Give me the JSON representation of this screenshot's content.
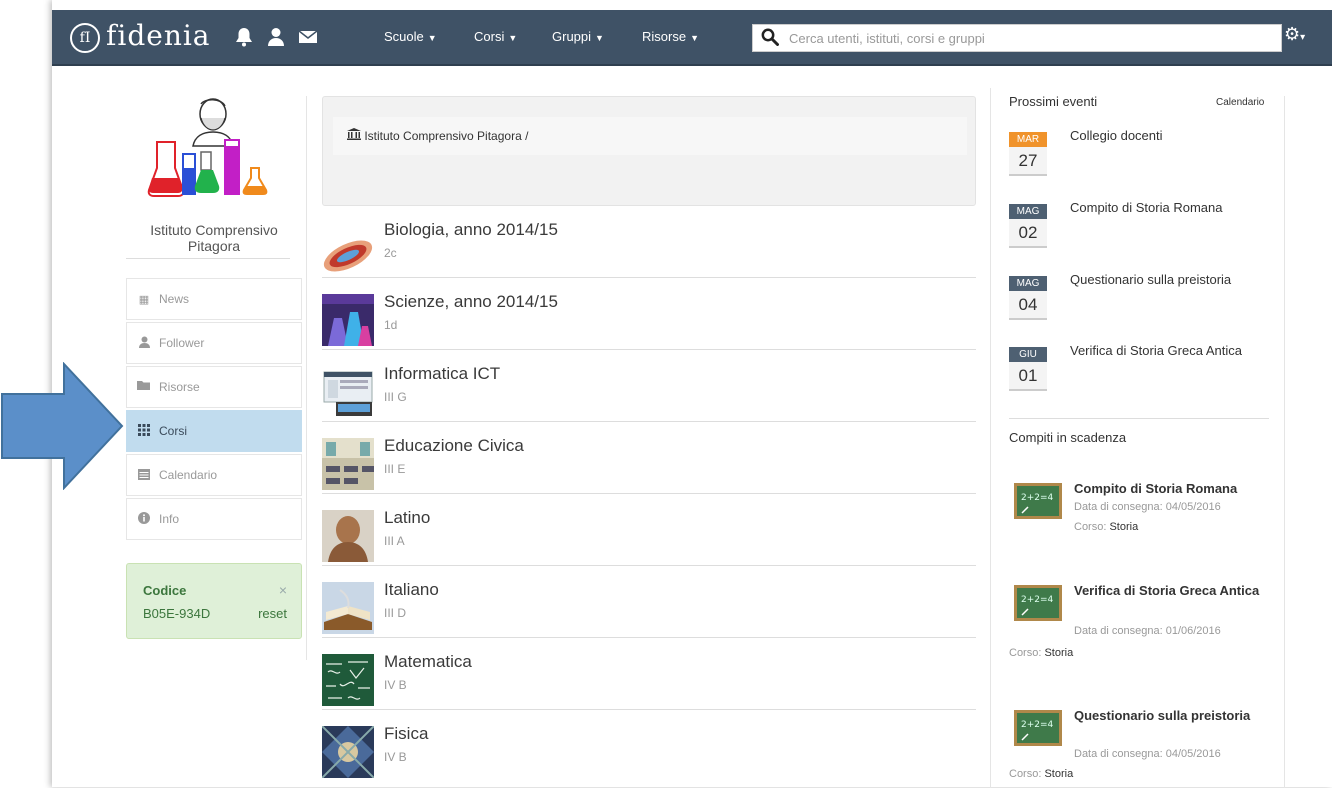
{
  "navbar": {
    "logo_mark": "fI",
    "logo_text": "fidenia",
    "menus": [
      {
        "label": "Scuole"
      },
      {
        "label": "Corsi"
      },
      {
        "label": "Gruppi"
      },
      {
        "label": "Risorse"
      }
    ],
    "search_placeholder": "Cerca utenti, istituti, corsi e gruppi",
    "colors": {
      "bar": "#3f5266"
    }
  },
  "school": {
    "name": "Istituto Comprensivo Pitagora"
  },
  "sidenav": {
    "items": [
      {
        "label": "News",
        "icon": "newspaper-icon"
      },
      {
        "label": "Follower",
        "icon": "user-icon"
      },
      {
        "label": "Risorse",
        "icon": "folder-icon"
      },
      {
        "label": "Corsi",
        "icon": "grid-icon",
        "active": true
      },
      {
        "label": "Calendario",
        "icon": "calendar-icon"
      },
      {
        "label": "Info",
        "icon": "info-icon"
      }
    ]
  },
  "code_box": {
    "title": "Codice",
    "close": "×",
    "value": "B05E-934D",
    "reset": "reset"
  },
  "breadcrumb": {
    "text": "Istituto Comprensivo Pitagora /"
  },
  "courses": [
    {
      "title": "Biologia, anno 2014/15",
      "sub": "2c"
    },
    {
      "title": "Scienze, anno 2014/15",
      "sub": "1d"
    },
    {
      "title": "Informatica ICT",
      "sub": "III G"
    },
    {
      "title": "Educazione Civica",
      "sub": "III E"
    },
    {
      "title": "Latino",
      "sub": "III A"
    },
    {
      "title": "Italiano",
      "sub": "III D"
    },
    {
      "title": "Matematica",
      "sub": "IV B"
    },
    {
      "title": "Fisica",
      "sub": "IV B"
    }
  ],
  "events": {
    "heading": "Prossimi eventi",
    "calendar_link": "Calendario",
    "items": [
      {
        "month": "MAR",
        "day": "27",
        "title": "Collegio docenti",
        "color": "#f0932b"
      },
      {
        "month": "MAG",
        "day": "02",
        "title": "Compito di Storia Romana",
        "color": "#4e6072"
      },
      {
        "month": "MAG",
        "day": "04",
        "title": "Questionario sulla preistoria",
        "color": "#4e6072"
      },
      {
        "month": "GIU",
        "day": "01",
        "title": "Verifica di Storia Greca Antica",
        "color": "#4e6072"
      }
    ]
  },
  "tasks": {
    "heading": "Compiti in scadenza",
    "items": [
      {
        "title": "Compito di Storia Romana",
        "due": "Data di consegna: 04/05/2016",
        "course_label": "Corso:",
        "course": "Storia"
      },
      {
        "title": "Verifica di Storia Greca Antica",
        "due": "Data di consegna: 01/06/2016",
        "course_label": "Corso:",
        "course": "Storia"
      },
      {
        "title": "Questionario sulla preistoria",
        "due": "Data di consegna: 04/05/2016",
        "course_label": "Corso:",
        "course": "Storia"
      }
    ]
  }
}
